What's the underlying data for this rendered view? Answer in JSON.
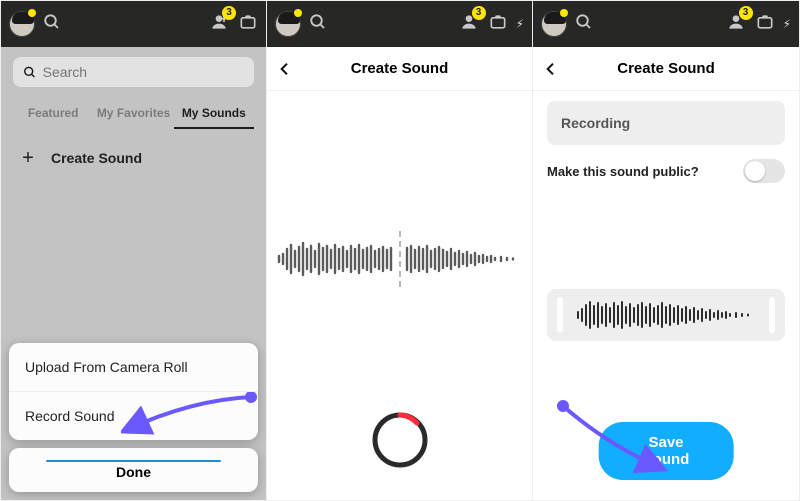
{
  "panel1": {
    "search_placeholder": "Search",
    "tabs": {
      "featured": "Featured",
      "favorites": "My Favorites",
      "sounds": "My Sounds"
    },
    "create_sound": "Create Sound",
    "sheet": {
      "upload": "Upload From Camera Roll",
      "record": "Record Sound",
      "done": "Done"
    },
    "badge_count": "3"
  },
  "panel2": {
    "title": "Create Sound",
    "badge_count": "3"
  },
  "panel3": {
    "title": "Create Sound",
    "recording_name": "Recording",
    "public_label": "Make this sound public?",
    "save_label": "Save Sound",
    "badge_count": "3"
  }
}
